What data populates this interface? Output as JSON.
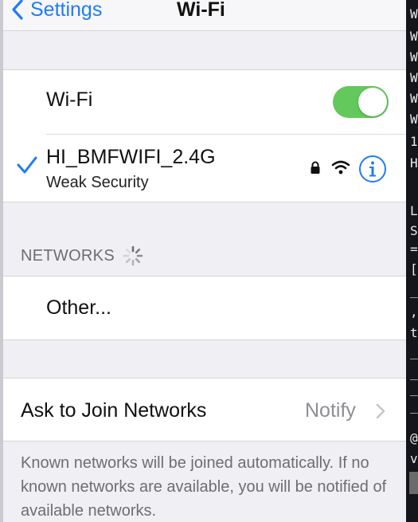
{
  "nav": {
    "back_label": "Settings",
    "title": "Wi-Fi"
  },
  "wifi_toggle": {
    "label": "Wi-Fi",
    "on": true,
    "color": "#63c95c"
  },
  "connected_network": {
    "name": "HI_BMFWIFI_2.4G",
    "subtitle": "Weak Security",
    "icons": [
      "checkmark-icon",
      "lock-icon",
      "wifi-signal-icon",
      "info-icon"
    ]
  },
  "networks_section": {
    "header": "NETWORKS",
    "other_label": "Other..."
  },
  "ask_to_join": {
    "label": "Ask to Join Networks",
    "value": "Notify"
  },
  "footer": {
    "text": "Known networks will be joined automatically. If no known networks are available, you will be notified of available networks."
  },
  "terminal_strip": {
    "lines": [
      "W",
      "W",
      "W",
      "W",
      "W",
      "W",
      "1",
      "H",
      "",
      "L",
      "S",
      "=",
      "[$",
      "_",
      ",",
      "t",
      "_",
      "_",
      "_",
      "_",
      "@",
      "v"
    ]
  },
  "colors": {
    "accent": "#1f7cf5",
    "toggle_on": "#63c95c",
    "background": "#efeff4",
    "secondary_text": "#6d6d72"
  }
}
